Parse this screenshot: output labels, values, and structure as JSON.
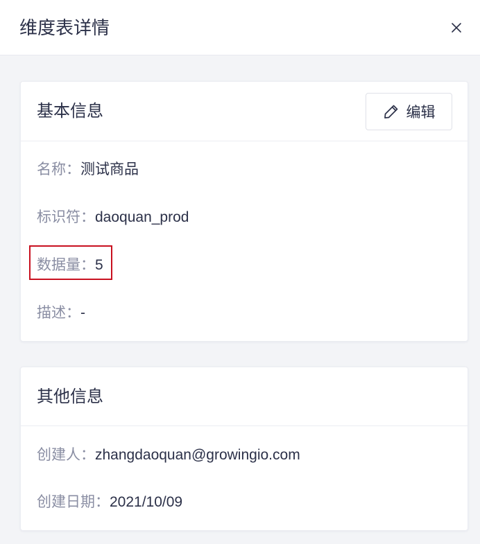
{
  "drawer": {
    "title": "维度表详情"
  },
  "basic_info": {
    "title": "基本信息",
    "edit_label": "编辑",
    "fields": [
      {
        "label": "名称：",
        "value": "测试商品"
      },
      {
        "label": "标识符：",
        "value": "daoquan_prod"
      },
      {
        "label": "数据量：",
        "value": "5"
      },
      {
        "label": "描述：",
        "value": "-"
      }
    ]
  },
  "other_info": {
    "title": "其他信息",
    "fields": [
      {
        "label": "创建人：",
        "value": "zhangdaoquan@growingio.com"
      },
      {
        "label": "创建日期：",
        "value": "2021/10/09"
      }
    ]
  },
  "icons": {
    "close": "close-icon",
    "edit": "pencil-icon"
  },
  "colors": {
    "highlight": "#c8101f",
    "label": "#8a8ea3",
    "value": "#2b3048",
    "background": "#f3f4f7"
  }
}
